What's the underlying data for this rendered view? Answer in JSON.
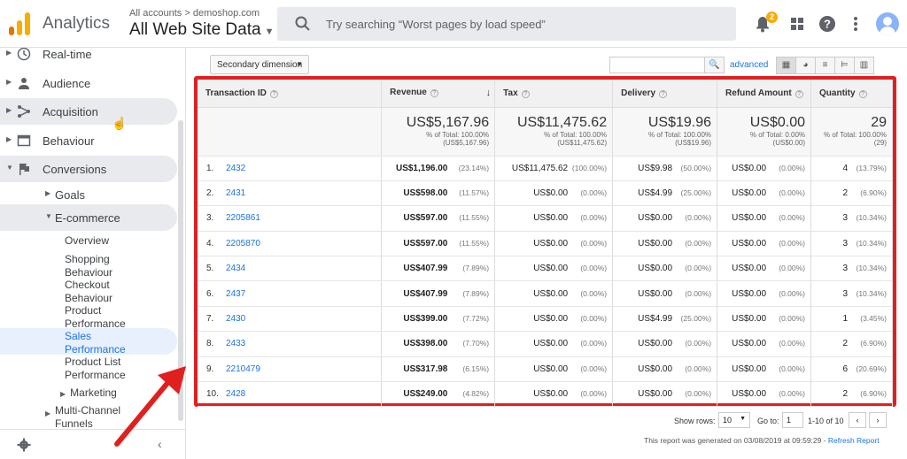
{
  "app": {
    "title": "Analytics"
  },
  "account": {
    "path": "All accounts > demoshop.com",
    "view": "All Web Site Data"
  },
  "search": {
    "placeholder": "Try searching “Worst pages by load speed”"
  },
  "header": {
    "notifications_count": "2"
  },
  "sidebar": {
    "items": [
      {
        "label": "Real-time",
        "icon": "clock-icon"
      },
      {
        "label": "Audience",
        "icon": "person-icon"
      },
      {
        "label": "Acquisition",
        "icon": "acquisition-icon"
      },
      {
        "label": "Behaviour",
        "icon": "behaviour-icon"
      },
      {
        "label": "Conversions",
        "icon": "flag-icon"
      }
    ],
    "sub": {
      "goals": "Goals",
      "ecommerce": "E-commerce",
      "overview": "Overview",
      "shopping_1": "Shopping",
      "shopping_2": "Behaviour",
      "checkout_1": "Checkout",
      "checkout_2": "Behaviour",
      "product_1": "Product",
      "product_2": "Performance",
      "sales_1": "Sales",
      "sales_2": "Performance",
      "plist_1": "Product List",
      "plist_2": "Performance",
      "marketing": "Marketing",
      "mcf_1": "Multi-Channel",
      "mcf_2": "Funnels"
    }
  },
  "toolbar": {
    "secondary_dimension": "Secondary dimension",
    "advanced": "advanced"
  },
  "table": {
    "headers": [
      "Transaction ID",
      "Revenue",
      "Tax",
      "Delivery",
      "Refund Amount",
      "Quantity"
    ],
    "totals": [
      {
        "value": "US$5,167.96",
        "pct": "% of Total: 100.00%",
        "of": "(US$5,167.96)"
      },
      {
        "value": "US$11,475.62",
        "pct": "% of Total: 100.00%",
        "of": "(US$11,475.62)"
      },
      {
        "value": "US$19.96",
        "pct": "% of Total: 100.00%",
        "of": "(US$19.96)"
      },
      {
        "value": "US$0.00",
        "pct": "% of Total: 0.00%",
        "of": "(US$0.00)"
      },
      {
        "value": "29",
        "pct": "% of Total: 100.00%",
        "of": "(29)"
      }
    ],
    "rows": [
      {
        "n": "1.",
        "id": "2432",
        "rev": "US$1,196.00",
        "rev_p": "(23.14%)",
        "tax": "US$11,475.62",
        "tax_p": "(100.00%)",
        "del": "US$9.98",
        "del_p": "(50.00%)",
        "ref": "US$0.00",
        "ref_p": "(0.00%)",
        "qty": "4",
        "qty_p": "(13.79%)"
      },
      {
        "n": "2.",
        "id": "2431",
        "rev": "US$598.00",
        "rev_p": "(11.57%)",
        "tax": "US$0.00",
        "tax_p": "(0.00%)",
        "del": "US$4.99",
        "del_p": "(25.00%)",
        "ref": "US$0.00",
        "ref_p": "(0.00%)",
        "qty": "2",
        "qty_p": "(6.90%)"
      },
      {
        "n": "3.",
        "id": "2205861",
        "rev": "US$597.00",
        "rev_p": "(11.55%)",
        "tax": "US$0.00",
        "tax_p": "(0.00%)",
        "del": "US$0.00",
        "del_p": "(0.00%)",
        "ref": "US$0.00",
        "ref_p": "(0.00%)",
        "qty": "3",
        "qty_p": "(10.34%)"
      },
      {
        "n": "4.",
        "id": "2205870",
        "rev": "US$597.00",
        "rev_p": "(11.55%)",
        "tax": "US$0.00",
        "tax_p": "(0.00%)",
        "del": "US$0.00",
        "del_p": "(0.00%)",
        "ref": "US$0.00",
        "ref_p": "(0.00%)",
        "qty": "3",
        "qty_p": "(10.34%)"
      },
      {
        "n": "5.",
        "id": "2434",
        "rev": "US$407.99",
        "rev_p": "(7.89%)",
        "tax": "US$0.00",
        "tax_p": "(0.00%)",
        "del": "US$0.00",
        "del_p": "(0.00%)",
        "ref": "US$0.00",
        "ref_p": "(0.00%)",
        "qty": "3",
        "qty_p": "(10.34%)"
      },
      {
        "n": "6.",
        "id": "2437",
        "rev": "US$407.99",
        "rev_p": "(7.89%)",
        "tax": "US$0.00",
        "tax_p": "(0.00%)",
        "del": "US$0.00",
        "del_p": "(0.00%)",
        "ref": "US$0.00",
        "ref_p": "(0.00%)",
        "qty": "3",
        "qty_p": "(10.34%)"
      },
      {
        "n": "7.",
        "id": "2430",
        "rev": "US$399.00",
        "rev_p": "(7.72%)",
        "tax": "US$0.00",
        "tax_p": "(0.00%)",
        "del": "US$4.99",
        "del_p": "(25.00%)",
        "ref": "US$0.00",
        "ref_p": "(0.00%)",
        "qty": "1",
        "qty_p": "(3.45%)"
      },
      {
        "n": "8.",
        "id": "2433",
        "rev": "US$398.00",
        "rev_p": "(7.70%)",
        "tax": "US$0.00",
        "tax_p": "(0.00%)",
        "del": "US$0.00",
        "del_p": "(0.00%)",
        "ref": "US$0.00",
        "ref_p": "(0.00%)",
        "qty": "2",
        "qty_p": "(6.90%)"
      },
      {
        "n": "9.",
        "id": "2210479",
        "rev": "US$317.98",
        "rev_p": "(6.15%)",
        "tax": "US$0.00",
        "tax_p": "(0.00%)",
        "del": "US$0.00",
        "del_p": "(0.00%)",
        "ref": "US$0.00",
        "ref_p": "(0.00%)",
        "qty": "6",
        "qty_p": "(20.69%)"
      },
      {
        "n": "10.",
        "id": "2428",
        "rev": "US$249.00",
        "rev_p": "(4.82%)",
        "tax": "US$0.00",
        "tax_p": "(0.00%)",
        "del": "US$0.00",
        "del_p": "(0.00%)",
        "ref": "US$0.00",
        "ref_p": "(0.00%)",
        "qty": "2",
        "qty_p": "(6.90%)"
      }
    ]
  },
  "pager": {
    "show_rows_label": "Show rows:",
    "show_rows_value": "10",
    "goto_label": "Go to:",
    "goto_value": "1",
    "range": "1-10 of 10"
  },
  "footer": {
    "report": "This report was generated on 03/08/2019 at 09:59:29 - ",
    "refresh": "Refresh Report"
  },
  "colors": {
    "accent": "#1a73e8",
    "highlight_box": "#e02020",
    "logo": "#f9ab00"
  }
}
